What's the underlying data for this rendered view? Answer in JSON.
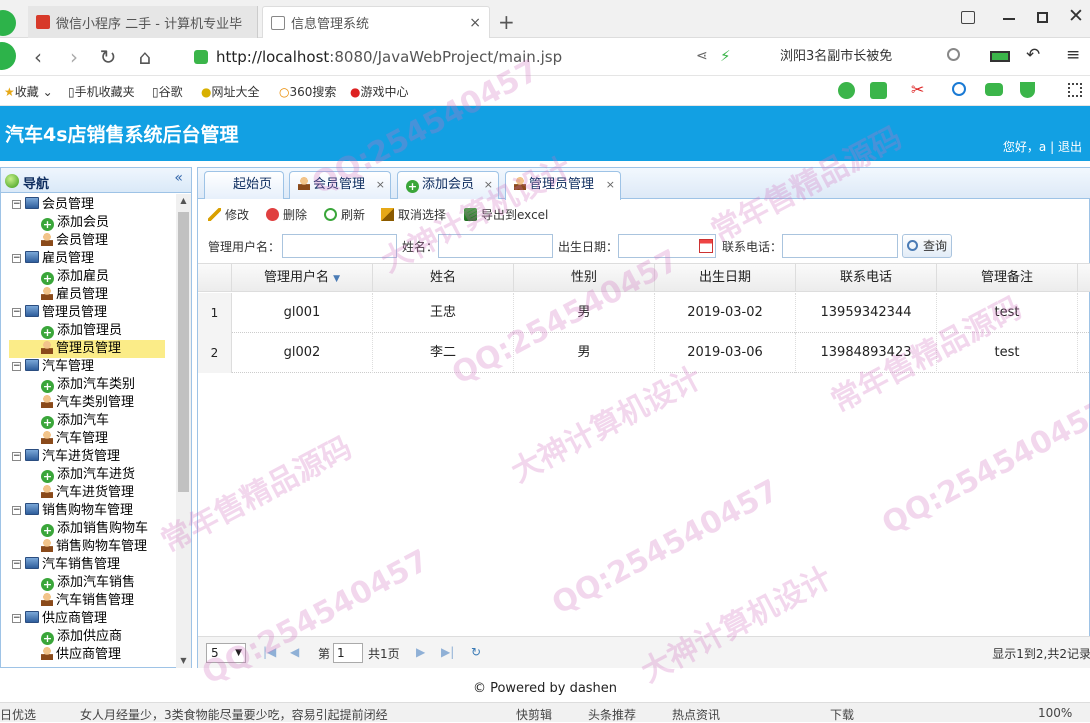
{
  "browser": {
    "tabs": [
      {
        "label": "微信小程序 二手 - 计算机专业毕"
      },
      {
        "label": "信息管理系统",
        "close": "×"
      }
    ],
    "new_tab": "+",
    "url_host": "http://localhost",
    "url_rest": ":8080/JavaWebProject/main.jsp",
    "search_text": "浏阳3名副市长被免"
  },
  "bookmarks": [
    "收藏",
    "手机收藏夹",
    "谷歌",
    "网址大全",
    "360搜索",
    "游戏中心"
  ],
  "app": {
    "title": "汽车4s店销售系统后台管理",
    "user_greeting": "您好，a",
    "separator": "|",
    "logout": "退出",
    "footer": "© Powered by dashen"
  },
  "nav": {
    "title": "导航",
    "collapse": "«",
    "groups": [
      {
        "label": "会员管理",
        "items": [
          "添加会员",
          "会员管理"
        ]
      },
      {
        "label": "雇员管理",
        "items": [
          "添加雇员",
          "雇员管理"
        ]
      },
      {
        "label": "管理员管理",
        "items": [
          "添加管理员",
          "管理员管理"
        ]
      },
      {
        "label": "汽车管理",
        "items": [
          "添加汽车类别",
          "汽车类别管理",
          "添加汽车",
          "汽车管理"
        ]
      },
      {
        "label": "汽车进货管理",
        "items": [
          "添加汽车进货",
          "汽车进货管理"
        ]
      },
      {
        "label": "销售购物车管理",
        "items": [
          "添加销售购物车",
          "销售购物车管理"
        ]
      },
      {
        "label": "汽车销售管理",
        "items": [
          "添加汽车销售",
          "汽车销售管理"
        ]
      },
      {
        "label": "供应商管理",
        "items": [
          "添加供应商",
          "供应商管理"
        ]
      }
    ]
  },
  "page_tabs": [
    {
      "label": "起始页"
    },
    {
      "label": "会员管理",
      "close": "×"
    },
    {
      "label": "添加会员",
      "close": "×"
    },
    {
      "label": "管理员管理",
      "close": "×"
    }
  ],
  "toolbar": {
    "edit": "修改",
    "delete": "删除",
    "refresh": "刷新",
    "cancel_select": "取消选择",
    "export": "导出到excel"
  },
  "search": {
    "username_label": "管理用户名：",
    "name_label": "姓名：",
    "birth_label": "出生日期：",
    "phone_label": "联系电话：",
    "query": "查询"
  },
  "table": {
    "columns": [
      "管理用户名",
      "姓名",
      "性别",
      "出生日期",
      "联系电话",
      "管理备注"
    ],
    "rows": [
      {
        "n": "1",
        "cells": [
          "gl001",
          "王忠",
          "男",
          "2019-03-02",
          "13959342344",
          "test"
        ]
      },
      {
        "n": "2",
        "cells": [
          "gl002",
          "李二",
          "男",
          "2019-03-06",
          "13984893423",
          "test"
        ]
      }
    ]
  },
  "pager": {
    "page_size": "5",
    "page_prefix": "第",
    "page_value": "1",
    "page_total": "共1页",
    "summary": "显示1到2,共2记录"
  },
  "statusbar": {
    "left": "日优选",
    "news": "女人月经量少，3类食物能尽量要少吃，容易引起提前闭经",
    "items": [
      "快剪辑",
      "头条推荐",
      "热点资讯",
      "下载",
      "100%"
    ]
  },
  "watermarks": [
    "QQ:254540457",
    "常年售精品源码",
    "大神计算机设计"
  ]
}
